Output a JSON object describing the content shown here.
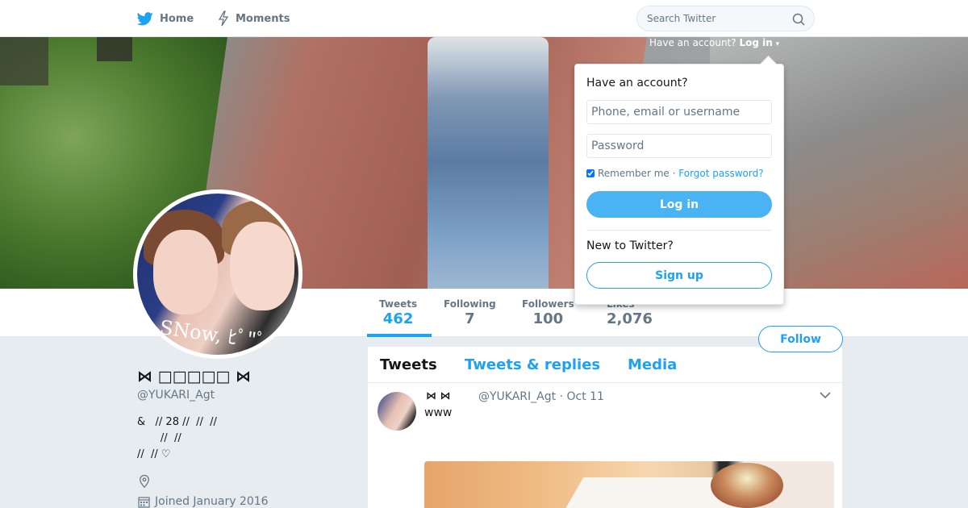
{
  "nav": {
    "home_label": "Home",
    "moments_label": "Moments",
    "search_placeholder": "Search Twitter"
  },
  "login_hint": {
    "prefix": "Have an account?",
    "link": "Log in"
  },
  "login_dropdown": {
    "title": "Have an account?",
    "username_placeholder": "Phone, email or username",
    "password_placeholder": "Password",
    "remember_label": "Remember me",
    "separator": "·",
    "forgot_label": "Forgot password?",
    "login_button": "Log in",
    "new_label": "New to Twitter?",
    "signup_button": "Sign up"
  },
  "stats": [
    {
      "label": "Tweets",
      "value": "462"
    },
    {
      "label": "Following",
      "value": "7"
    },
    {
      "label": "Followers",
      "value": "100"
    },
    {
      "label": "Likes",
      "value": "2,076"
    }
  ],
  "follow_button": "Follow",
  "profile": {
    "name": "⋈ □□□□□ ⋈",
    "handle": "@YUKARI_Agt",
    "bio_lines": [
      "&   // 28 //  //  //",
      "       //  //",
      "//  // ♡"
    ],
    "joined": "Joined January 2016",
    "avatar_caption": "SNow, ﾋﾟ\"ﾟ"
  },
  "timeline": {
    "tabs": [
      "Tweets",
      "Tweets & replies",
      "Media"
    ],
    "tweet": {
      "name": "⋈  ⋈",
      "meta": "@YUKARI_Agt · Oct 11",
      "text": "www"
    }
  },
  "colors": {
    "accent": "#1da1f2",
    "login_button": "#4ab3f4",
    "page_bg": "#e6ecf0"
  }
}
